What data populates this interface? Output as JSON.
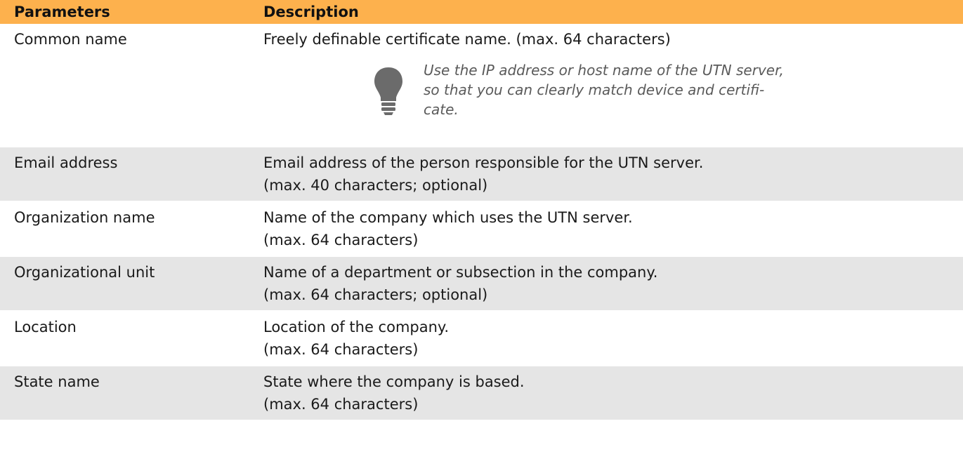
{
  "table": {
    "header": {
      "parameters": "Parameters",
      "description": "Description"
    },
    "rows": [
      {
        "param": "Common name",
        "desc_lines": [
          "Freely definable certificate name. (max. 64 characters)"
        ],
        "tip_lines": [
          "Use the IP address or host name of the UTN server,",
          "so that you can clearly match device and certifi-",
          "cate."
        ]
      },
      {
        "param": "Email address",
        "desc_lines": [
          "Email address of the person responsible for the UTN server.",
          "(max. 40 characters; optional)"
        ]
      },
      {
        "param": "Organization name",
        "desc_lines": [
          "Name of the company which uses the UTN server.",
          "(max. 64 characters)"
        ]
      },
      {
        "param": "Organizational unit",
        "desc_lines": [
          "Name of a department or subsection in the company.",
          "(max. 64 characters; optional)"
        ]
      },
      {
        "param": "Location",
        "desc_lines": [
          "Location of the company.",
          "(max. 64 characters)"
        ]
      },
      {
        "param": "State name",
        "desc_lines": [
          "State where the company is based.",
          "(max. 64 characters)"
        ]
      }
    ]
  },
  "icons": {
    "tip": "lightbulb-icon"
  },
  "colors": {
    "header_bg": "#fdb14d",
    "row_alt_bg": "#e5e5e5",
    "tip_text": "#5a5a5a",
    "icon_gray": "#6b6b6b"
  }
}
